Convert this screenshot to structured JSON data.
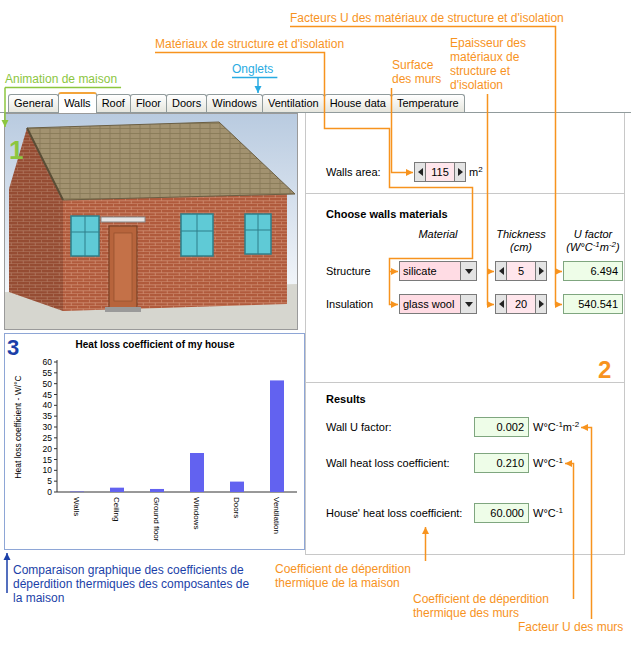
{
  "annotations": [
    {
      "text": "Facteurs U des matériaux de structure et d'isolation",
      "color": "#f7931e"
    },
    {
      "text": "Matériaux de structure et d'isolation",
      "color": "#f7931e"
    },
    {
      "text": "Surface des murs",
      "color": "#f7931e"
    },
    {
      "text": "Epaisseur des matériaux de structure et d'isolation",
      "color": "#f7931e"
    },
    {
      "text": "Animation de maison",
      "color": "#8cc63f"
    },
    {
      "text": "Onglets",
      "color": "#29abe2"
    },
    {
      "text": "Comparaison graphique des coefficients de déperdition thermiques des composantes de la maison",
      "color": "#1b3fa8"
    },
    {
      "text": "Coefficient de déperdition thermique de la maison",
      "color": "#f7931e"
    },
    {
      "text": "Coefficient de déperdition thermique des murs",
      "color": "#f7931e"
    },
    {
      "text": "Facteur U des murs",
      "color": "#f7931e"
    }
  ],
  "markers": [
    {
      "text": "1",
      "color": "#8cc63f"
    },
    {
      "text": "2",
      "color": "#f7931e"
    },
    {
      "text": "3",
      "color": "#1b3fa8"
    }
  ],
  "tabs": [
    {
      "label": "General",
      "selected": false
    },
    {
      "label": "Walls",
      "selected": true
    },
    {
      "label": "Roof",
      "selected": false
    },
    {
      "label": "Floor",
      "selected": false
    },
    {
      "label": "Doors",
      "selected": false
    },
    {
      "label": "Windows",
      "selected": false
    },
    {
      "label": "Ventilation",
      "selected": false
    },
    {
      "label": "House data",
      "selected": false
    },
    {
      "label": "Temperature",
      "selected": false
    }
  ],
  "walls_area": {
    "label": "Walls area:",
    "value": "115",
    "unit": [
      {
        "text": "m",
        "sup": false
      },
      {
        "text": "2",
        "sup": true
      }
    ]
  },
  "materials": {
    "title": "Choose walls materials",
    "header": {
      "material": "Material",
      "thickness": "Thickness",
      "thickness_unit": "(cm)",
      "u_factor": "U factor",
      "u_unit": [
        {
          "text": "(W°C",
          "sup": false
        },
        {
          "text": "-1",
          "sup": true
        },
        {
          "text": "m",
          "sup": false
        },
        {
          "text": "-2",
          "sup": true
        },
        {
          "text": ")",
          "sup": false
        }
      ]
    },
    "rows": [
      {
        "label": "Structure",
        "material": "silicate",
        "thickness": "5",
        "u_factor": "6.494"
      },
      {
        "label": "Insulation",
        "material": "glass wool",
        "thickness": "20",
        "u_factor": "540.541"
      }
    ]
  },
  "results": {
    "title": "Results",
    "rows": [
      {
        "label": "Wall U factor:",
        "value": "0.002",
        "unit": [
          {
            "text": "W°C",
            "sup": false
          },
          {
            "text": "-1",
            "sup": true
          },
          {
            "text": "m",
            "sup": false
          },
          {
            "text": "-2",
            "sup": true
          }
        ]
      },
      {
        "label": "Wall heat loss coefficient:",
        "value": "0.210",
        "unit": [
          {
            "text": "W°C",
            "sup": false
          },
          {
            "text": "-1",
            "sup": true
          }
        ]
      },
      {
        "label": "House' heat loss coefficient:",
        "value": "60.000",
        "unit": [
          {
            "text": "W°C",
            "sup": false
          },
          {
            "text": "-1",
            "sup": true
          }
        ]
      }
    ]
  },
  "chart": {
    "title": "Heat loss coefficient of my house",
    "y_label": "Heat loss coefficient - W/°C",
    "y_ticks": [
      "0",
      "5",
      "10",
      "15",
      "20",
      "25",
      "30",
      "35",
      "40",
      "45",
      "50",
      "55",
      "60"
    ],
    "categories": [
      "Walls",
      "Ceiling",
      "Ground floor",
      "Windows",
      "Doors",
      "Ventilation"
    ],
    "values": [
      0.21,
      2.0,
      1.4,
      18.0,
      4.8,
      51.5
    ]
  }
}
